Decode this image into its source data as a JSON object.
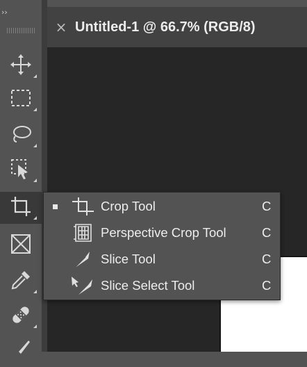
{
  "toolbar": {
    "collapse_label": "››",
    "tools": [
      {
        "name": "move-tool",
        "icon": "move-icon"
      },
      {
        "name": "marquee-tool",
        "icon": "rect-marquee-icon"
      },
      {
        "name": "lasso-tool",
        "icon": "lasso-icon"
      },
      {
        "name": "object-selection-tool",
        "icon": "object-selection-icon"
      },
      {
        "name": "crop-tool",
        "icon": "crop-icon",
        "active": true
      },
      {
        "name": "frame-tool",
        "icon": "frame-icon"
      },
      {
        "name": "eyedropper-tool",
        "icon": "eyedropper-icon"
      },
      {
        "name": "healing-brush-tool",
        "icon": "bandage-icon"
      },
      {
        "name": "brush-tool",
        "icon": "brush-icon"
      }
    ]
  },
  "document": {
    "close_glyph": "×",
    "title": "Untitled-1 @ 66.7% (RGB/8)"
  },
  "flyout": {
    "items": [
      {
        "label": "Crop Tool",
        "shortcut": "C",
        "icon": "crop-icon",
        "selected": true
      },
      {
        "label": "Perspective Crop Tool",
        "shortcut": "C",
        "icon": "perspective-crop-icon",
        "selected": false
      },
      {
        "label": "Slice Tool",
        "shortcut": "C",
        "icon": "slice-icon",
        "selected": false
      },
      {
        "label": "Slice Select Tool",
        "shortcut": "C",
        "icon": "slice-select-icon",
        "selected": false
      }
    ]
  },
  "colors": {
    "panel": "#535353",
    "canvas": "#262626",
    "tab": "#424242",
    "text": "#ededed"
  }
}
